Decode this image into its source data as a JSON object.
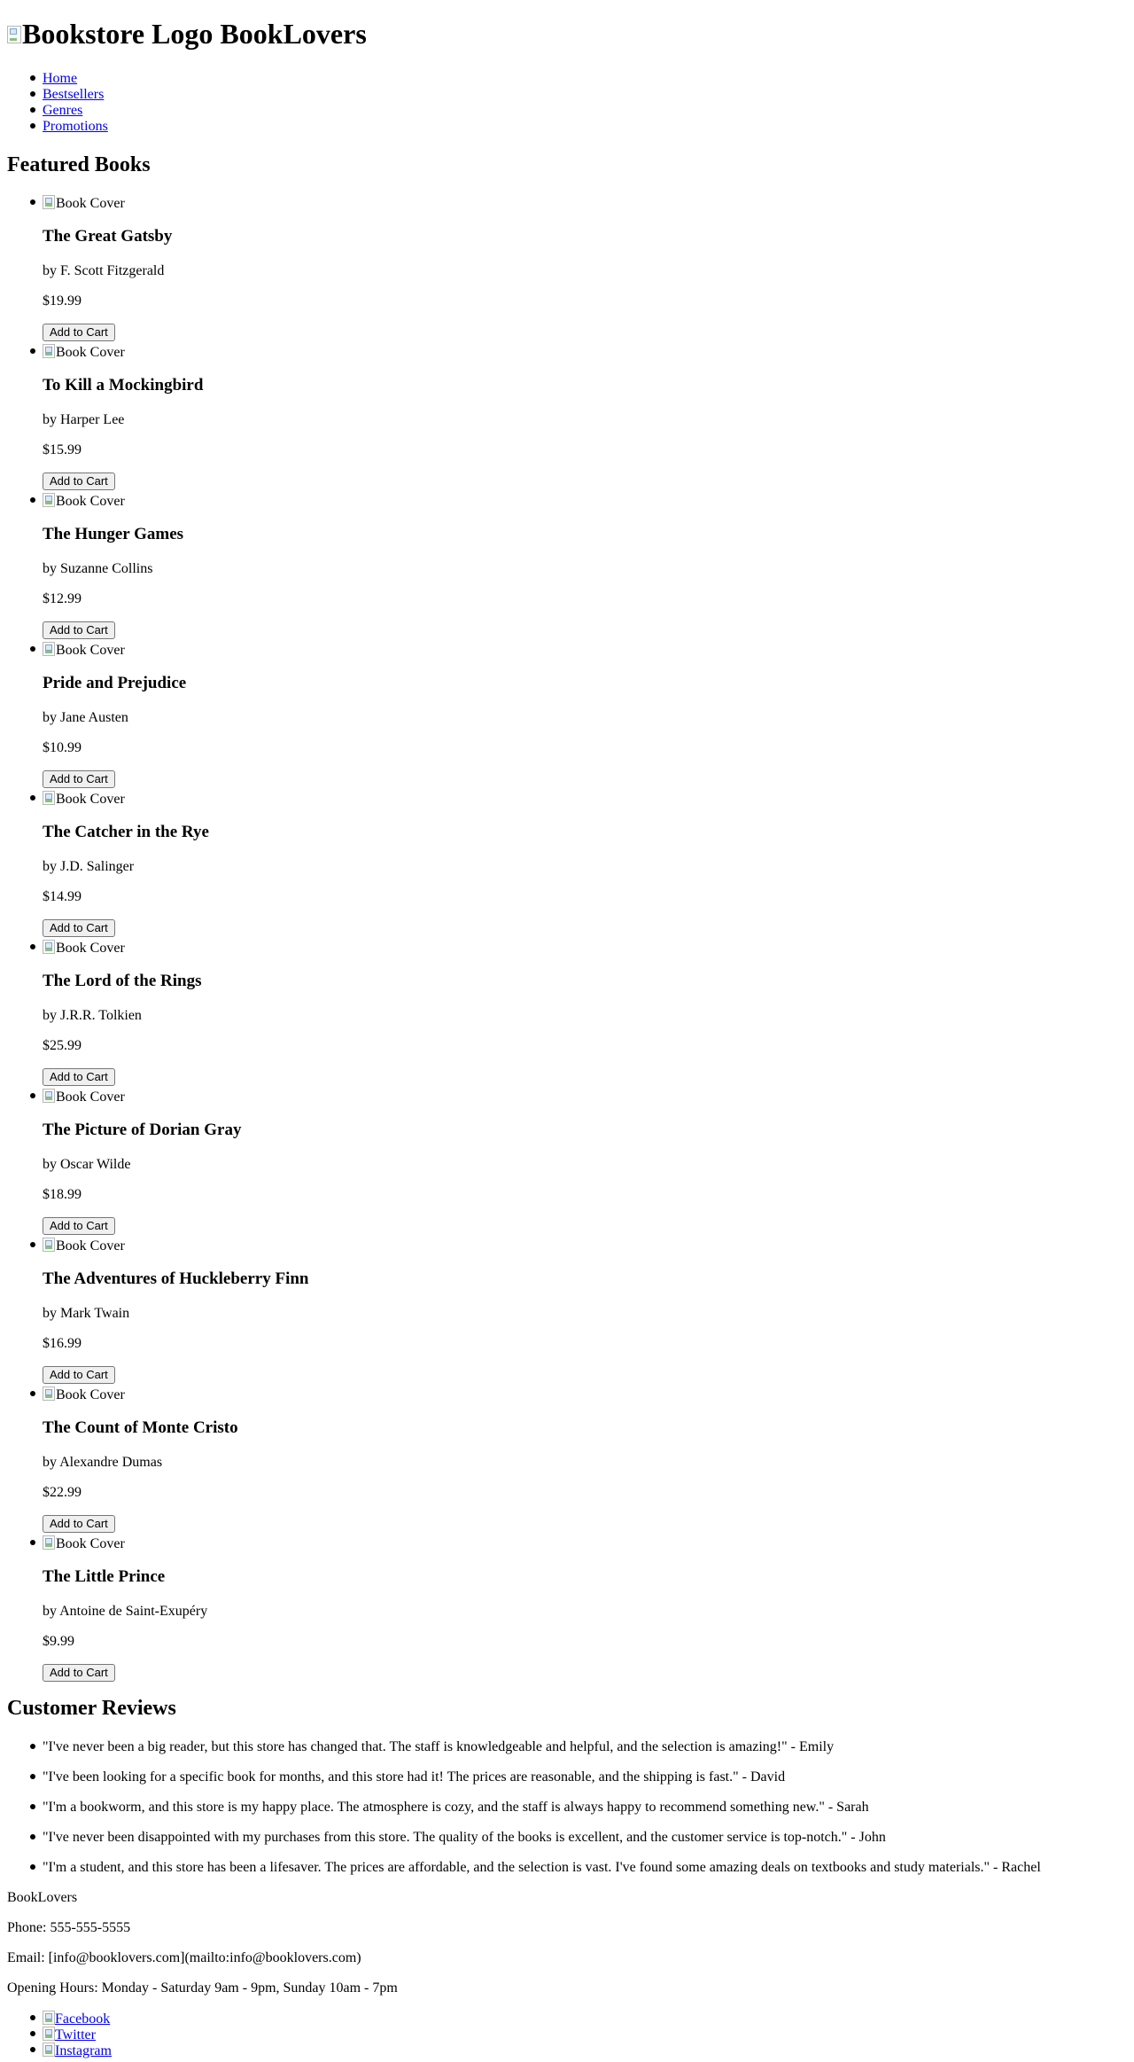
{
  "header": {
    "logo_alt": "Bookstore Logo",
    "site_name": "BookLovers"
  },
  "nav": [
    {
      "label": "Home"
    },
    {
      "label": "Bestsellers"
    },
    {
      "label": "Genres"
    },
    {
      "label": "Promotions"
    }
  ],
  "featured": {
    "heading": "Featured Books",
    "cover_alt": "Book Cover",
    "add_label": "Add to Cart",
    "books": [
      {
        "title": "The Great Gatsby",
        "author": "by F. Scott Fitzgerald",
        "price": "$19.99"
      },
      {
        "title": "To Kill a Mockingbird",
        "author": "by Harper Lee",
        "price": "$15.99"
      },
      {
        "title": "The Hunger Games",
        "author": "by Suzanne Collins",
        "price": "$12.99"
      },
      {
        "title": "Pride and Prejudice",
        "author": "by Jane Austen",
        "price": "$10.99"
      },
      {
        "title": "The Catcher in the Rye",
        "author": "by J.D. Salinger",
        "price": "$14.99"
      },
      {
        "title": "The Lord of the Rings",
        "author": "by J.R.R. Tolkien",
        "price": "$25.99"
      },
      {
        "title": "The Picture of Dorian Gray",
        "author": "by Oscar Wilde",
        "price": "$18.99"
      },
      {
        "title": "The Adventures of Huckleberry Finn",
        "author": "by Mark Twain",
        "price": "$16.99"
      },
      {
        "title": "The Count of Monte Cristo",
        "author": "by Alexandre Dumas",
        "price": "$22.99"
      },
      {
        "title": "The Little Prince",
        "author": "by Antoine de Saint-Exupéry",
        "price": "$9.99"
      }
    ]
  },
  "reviews": {
    "heading": "Customer Reviews",
    "items": [
      "\"I've never been a big reader, but this store has changed that. The staff is knowledgeable and helpful, and the selection is amazing!\" - Emily",
      "\"I've been looking for a specific book for months, and this store had it! The prices are reasonable, and the shipping is fast.\" - David",
      "\"I'm a bookworm, and this store is my happy place. The atmosphere is cozy, and the staff is always happy to recommend something new.\" - Sarah",
      "\"I've never been disappointed with my purchases from this store. The quality of the books is excellent, and the customer service is top-notch.\" - John",
      "\"I'm a student, and this store has been a lifesaver. The prices are affordable, and the selection is vast. I've found some amazing deals on textbooks and study materials.\" - Rachel"
    ]
  },
  "footer": {
    "name": "BookLovers",
    "phone": "Phone: 555-555-5555",
    "email": "Email: [info@booklovers.com](mailto:info@booklovers.com)",
    "hours": "Opening Hours: Monday - Saturday 9am - 9pm, Sunday 10am - 7pm",
    "social": [
      {
        "label": "Facebook",
        "icon": "facebook-icon"
      },
      {
        "label": "Twitter",
        "icon": "twitter-icon"
      },
      {
        "label": "Instagram",
        "icon": "instagram-icon"
      }
    ]
  }
}
